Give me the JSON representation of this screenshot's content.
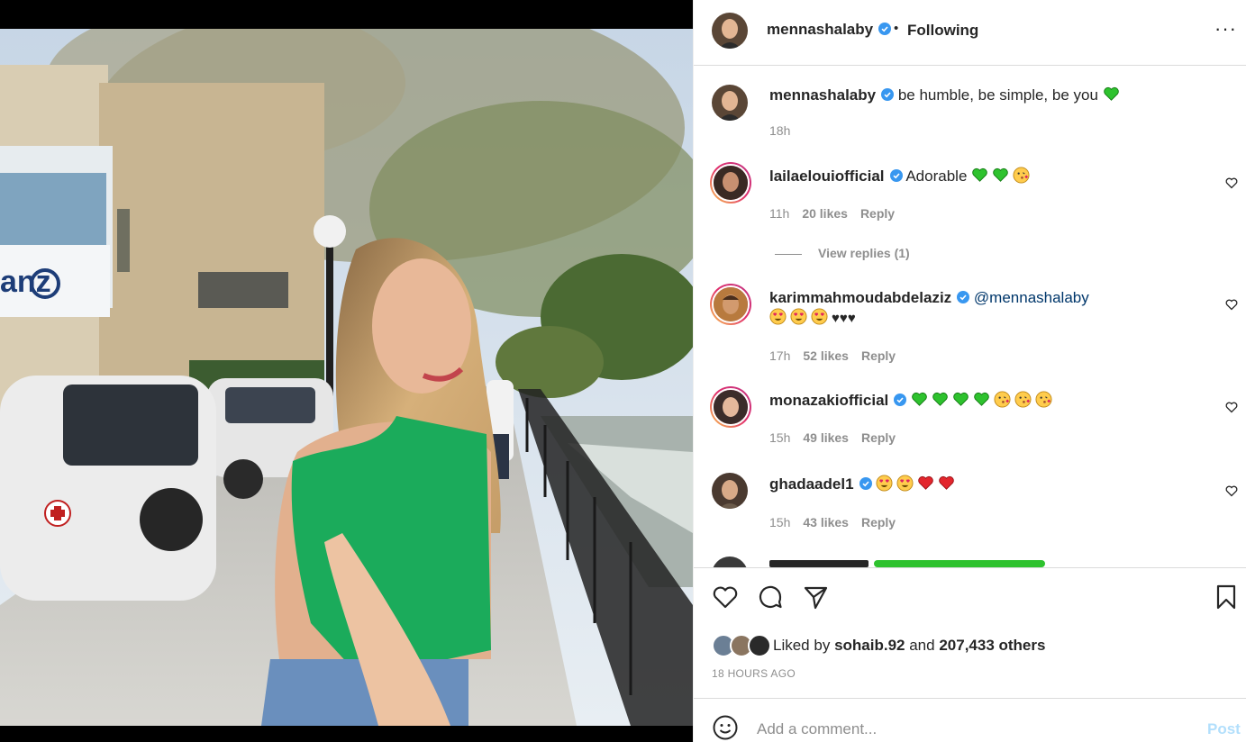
{
  "post": {
    "author": "mennashalaby",
    "follow_status": "Following",
    "dot": "•",
    "more_icon": "more-horizontal-icon"
  },
  "caption": {
    "username": "mennashalaby",
    "text": "be humble, be simple, be you",
    "emoji": [
      "green-heart"
    ],
    "time": "18h"
  },
  "comments": [
    {
      "username": "lailaelouiofficial",
      "text": "Adorable",
      "emoji": [
        "green-heart",
        "green-heart",
        "kiss-face"
      ],
      "time": "11h",
      "likes": "20 likes",
      "reply": "Reply",
      "view_replies": "View replies (1)"
    },
    {
      "username": "karimmahmoudabdelaziz",
      "mention": "@mennashalaby",
      "emoji": [
        "heart-eyes",
        "heart-eyes",
        "heart-eyes"
      ],
      "hearts_text": "♥♥♥",
      "time": "17h",
      "likes": "52 likes",
      "reply": "Reply"
    },
    {
      "username": "monazakiofficial",
      "text": "",
      "emoji": [
        "green-heart",
        "green-heart",
        "green-heart",
        "green-heart",
        "kiss-face",
        "kiss-face",
        "kiss-face"
      ],
      "time": "15h",
      "likes": "49 likes",
      "reply": "Reply"
    },
    {
      "username": "ghadaadel1",
      "text": "",
      "emoji": [
        "heart-eyes",
        "heart-eyes",
        "red-heart",
        "red-heart"
      ],
      "time": "15h",
      "likes": "43 likes",
      "reply": "Reply"
    }
  ],
  "likes": {
    "prefix": "Liked by",
    "user": "sohaib.92",
    "and": "and",
    "others": "207,433 others"
  },
  "timestamp": "18 HOURS AGO",
  "add_comment": {
    "placeholder": "Add a comment...",
    "post_label": "Post"
  },
  "colors": {
    "verified": "#3897f0",
    "link": "#00376b",
    "muted": "#8e8e8e",
    "text": "#262626",
    "post_disabled": "#b2dffc"
  }
}
